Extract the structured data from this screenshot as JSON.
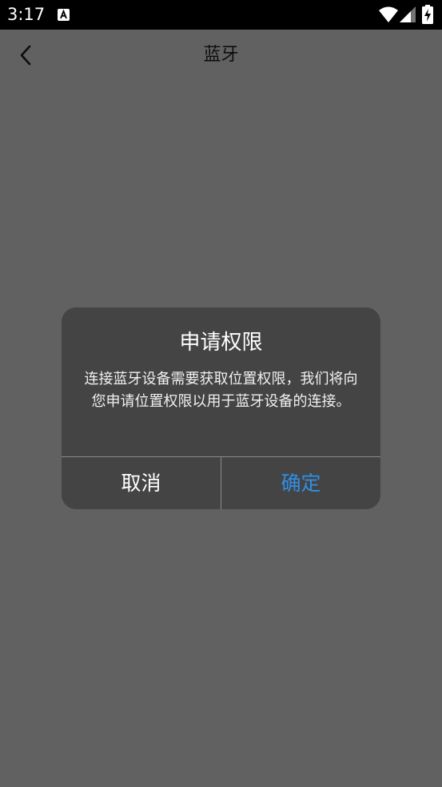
{
  "status_bar": {
    "time": "3:17",
    "icons": [
      "a-notification-icon",
      "wifi-icon",
      "cell-signal-icon",
      "battery-charging-icon"
    ]
  },
  "app_bar": {
    "title": "蓝牙",
    "back_icon": "chevron-left-icon"
  },
  "dialog": {
    "title": "申请权限",
    "message": "连接蓝牙设备需要获取位置权限，我们将向您申请位置权限以用于蓝牙设备的连接。",
    "cancel_label": "取消",
    "confirm_label": "确定"
  },
  "colors": {
    "status_bar": "#000000",
    "scrim": "#5f6062",
    "dialog_background": "#444444",
    "confirm_accent": "#2f8fe6",
    "divider": "#8a8a8a"
  }
}
